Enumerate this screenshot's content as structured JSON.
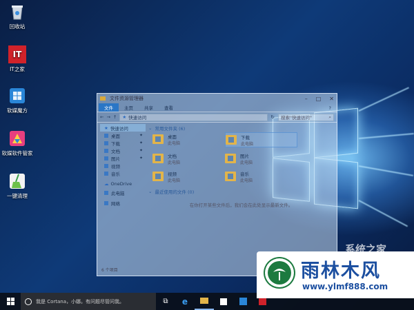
{
  "desktop": {
    "icons": [
      {
        "label": "回收站"
      },
      {
        "label": "IT之家",
        "badge": "IT"
      },
      {
        "label": "软媒魔方"
      },
      {
        "label": "软媒软件管家"
      },
      {
        "label": "一键清理"
      }
    ]
  },
  "window": {
    "title": "文件资源管理器",
    "ribbon_tabs": [
      "文件",
      "主页",
      "共享",
      "查看"
    ],
    "address": "快速访问",
    "search_placeholder": "搜索\"快速访问\"",
    "nav": [
      {
        "label": "快速访问"
      },
      {
        "label": "桌面"
      },
      {
        "label": "下载"
      },
      {
        "label": "文档"
      },
      {
        "label": "图片"
      },
      {
        "label": "视频"
      },
      {
        "label": "音乐"
      },
      {
        "label": "OneDrive"
      },
      {
        "label": "此电脑"
      },
      {
        "label": "网络"
      }
    ],
    "frequent_header": "常用文件夹 (6)",
    "folders": [
      {
        "name": "桌面",
        "loc": "此电脑"
      },
      {
        "name": "下载",
        "loc": "此电脑"
      },
      {
        "name": "文档",
        "loc": "此电脑"
      },
      {
        "name": "图片",
        "loc": "此电脑"
      },
      {
        "name": "视频",
        "loc": "此电脑"
      },
      {
        "name": "音乐",
        "loc": "此电脑"
      }
    ],
    "recent_header": "最近使用的文件 (0)",
    "recent_empty": "在你打开某些文件后，我们会在此处显示最新文件。",
    "status": "6 个项目"
  },
  "taskbar": {
    "cortana": "我是 Cortana，小娜。有问题尽管问我。"
  },
  "watermark": {
    "brand_bg": "系统之家",
    "title": "雨林木风",
    "url": "www.ylmf888.com"
  }
}
